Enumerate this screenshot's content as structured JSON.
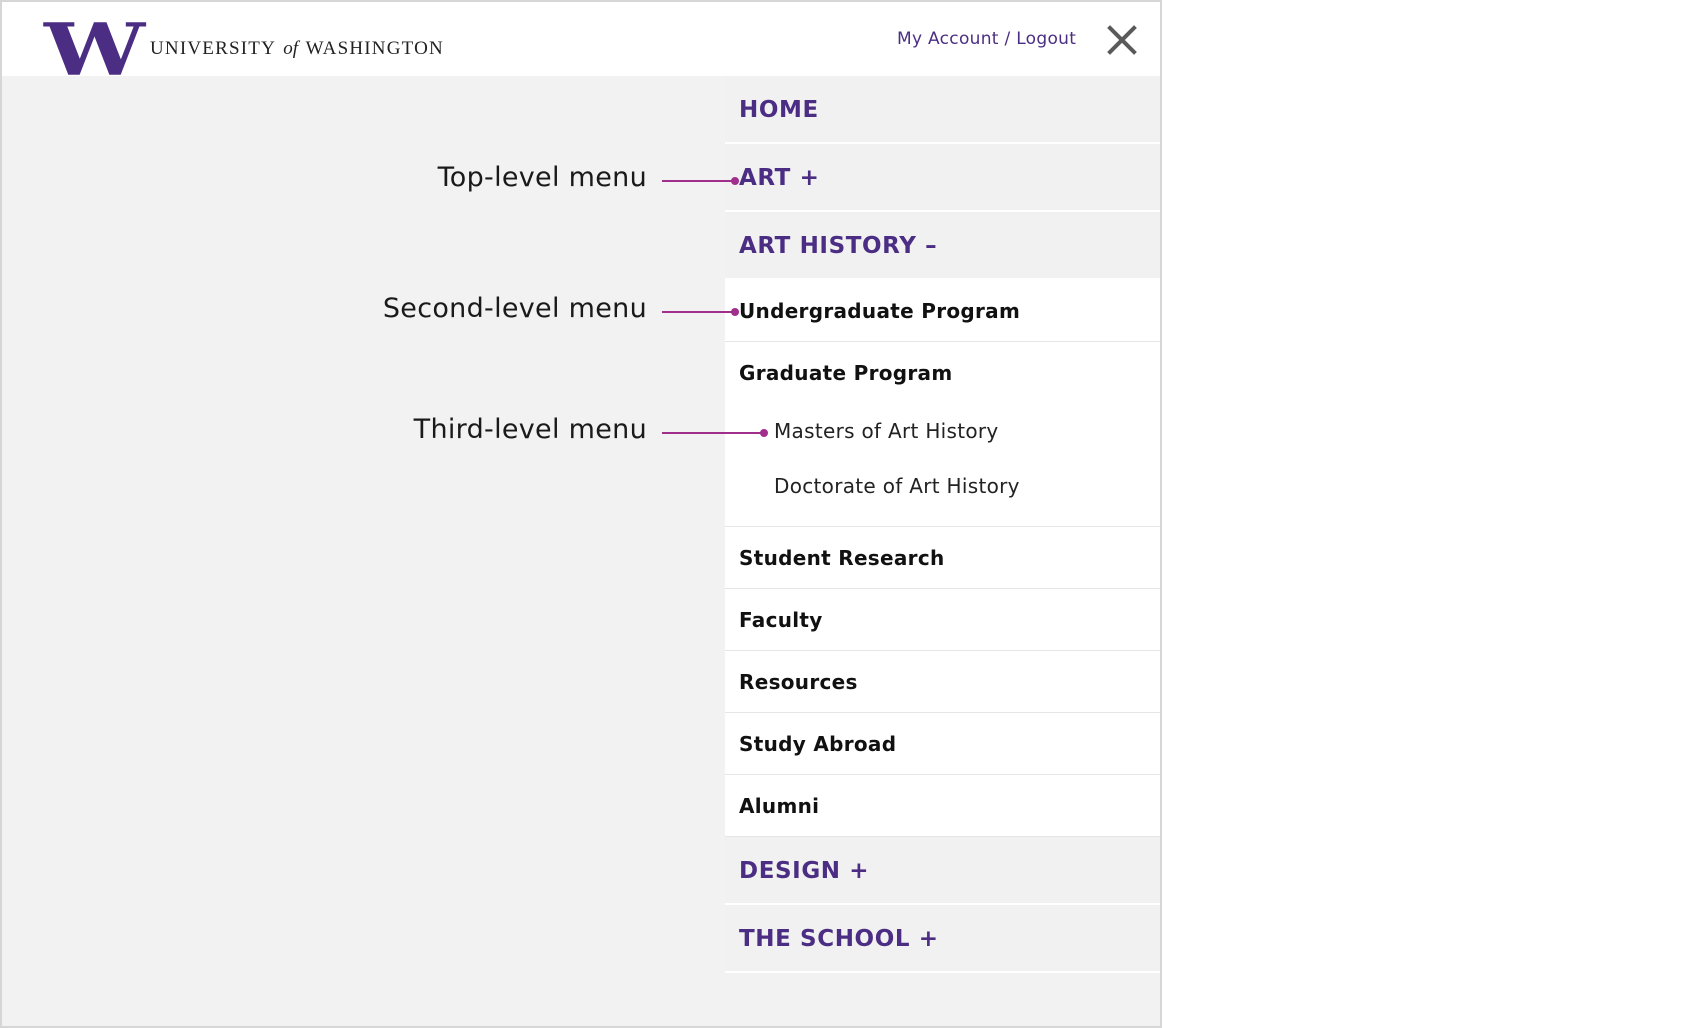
{
  "header": {
    "logo_letter": "W",
    "wordmark": {
      "pre": "UNIVERSITY",
      "of": "of",
      "post": "WASHINGTON"
    },
    "account_link": "My Account / Logout"
  },
  "menu": {
    "top_items": [
      {
        "label": "HOME"
      },
      {
        "label": "ART +"
      },
      {
        "label": "ART HISTORY –"
      },
      {
        "label": "DESIGN +"
      },
      {
        "label": "THE SCHOOL +"
      }
    ],
    "art_history_children": [
      {
        "label": "Undergraduate Program"
      },
      {
        "label": "Graduate Program"
      },
      {
        "label": "Student Research"
      },
      {
        "label": "Faculty"
      },
      {
        "label": "Resources"
      },
      {
        "label": "Study Abroad"
      },
      {
        "label": "Alumni"
      }
    ],
    "graduate_children": [
      {
        "label": "Masters of Art History"
      },
      {
        "label": "Doctorate of Art History"
      }
    ]
  },
  "annotations": {
    "top_level": "Top-level menu",
    "second_level": "Second-level menu",
    "third_level": "Third-level menu"
  },
  "colors": {
    "brand_purple": "#4b2e83",
    "annotation_line": "#a02f8c",
    "menu_top_bg": "#f1f1f1",
    "page_bg": "#f2f2f2"
  },
  "icons": {
    "close": "close-icon",
    "logo": "uw-w-logo-icon"
  }
}
